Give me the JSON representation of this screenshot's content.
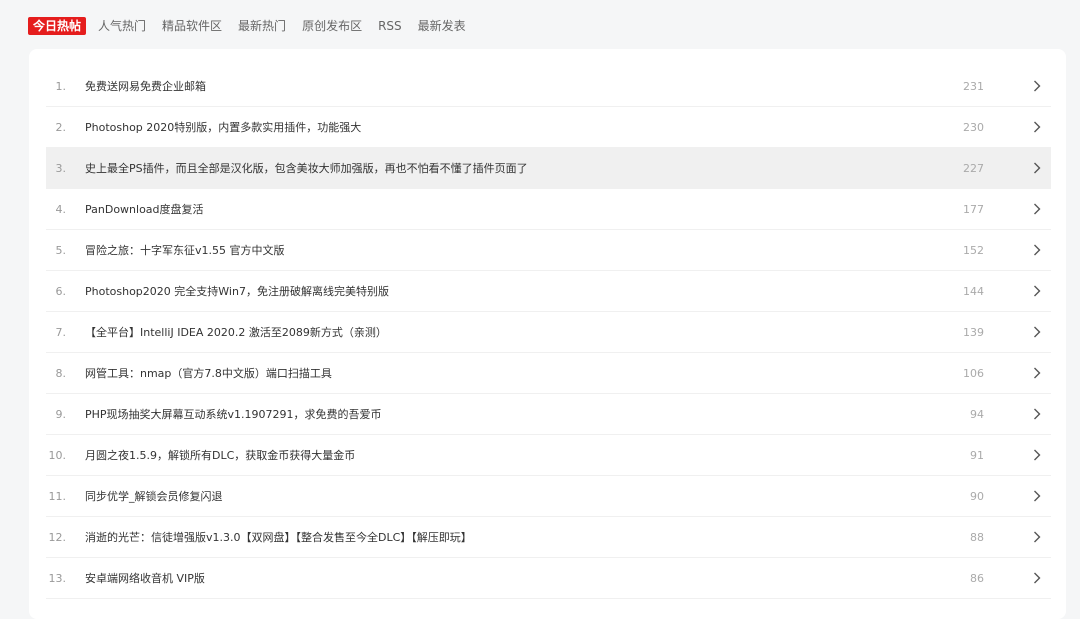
{
  "tabs": [
    {
      "label": "今日热帖",
      "active": true
    },
    {
      "label": "人气热门",
      "active": false
    },
    {
      "label": "精品软件区",
      "active": false
    },
    {
      "label": "最新热门",
      "active": false
    },
    {
      "label": "原创发布区",
      "active": false
    },
    {
      "label": "RSS",
      "active": false
    },
    {
      "label": "最新发表",
      "active": false
    }
  ],
  "accent_color": "#e51d1d",
  "items": [
    {
      "index": "1.",
      "title": "免费送网易免费企业邮箱",
      "count": "231"
    },
    {
      "index": "2.",
      "title": "Photoshop 2020特别版，内置多款实用插件，功能强大",
      "count": "230"
    },
    {
      "index": "3.",
      "title": "史上最全PS插件，而且全部是汉化版，包含美妆大师加强版，再也不怕看不懂了插件页面了",
      "count": "227"
    },
    {
      "index": "4.",
      "title": "PanDownload度盘复活",
      "count": "177"
    },
    {
      "index": "5.",
      "title": "冒险之旅：十字军东征v1.55 官方中文版",
      "count": "152"
    },
    {
      "index": "6.",
      "title": "Photoshop2020 完全支持Win7，免注册破解离线完美特别版",
      "count": "144"
    },
    {
      "index": "7.",
      "title": "【全平台】IntelliJ IDEA 2020.2 激活至2089新方式（亲测）",
      "count": "139"
    },
    {
      "index": "8.",
      "title": "网管工具：nmap（官方7.8中文版）端口扫描工具",
      "count": "106"
    },
    {
      "index": "9.",
      "title": "PHP现场抽奖大屏幕互动系统v1.1907291，求免费的吾爱币",
      "count": "94"
    },
    {
      "index": "10.",
      "title": "月圆之夜1.5.9，解锁所有DLC，获取金币获得大量金币",
      "count": "91"
    },
    {
      "index": "11.",
      "title": "同步优学_解锁会员修复闪退",
      "count": "90"
    },
    {
      "index": "12.",
      "title": "消逝的光芒：信徒增强版v1.3.0【双网盘】【整合发售至今全DLC】【解压即玩】",
      "count": "88"
    },
    {
      "index": "13.",
      "title": "安卓端网络收音机 VIP版",
      "count": "86"
    }
  ],
  "hover_index": 2,
  "chevron_icon": "chevron-right-icon"
}
